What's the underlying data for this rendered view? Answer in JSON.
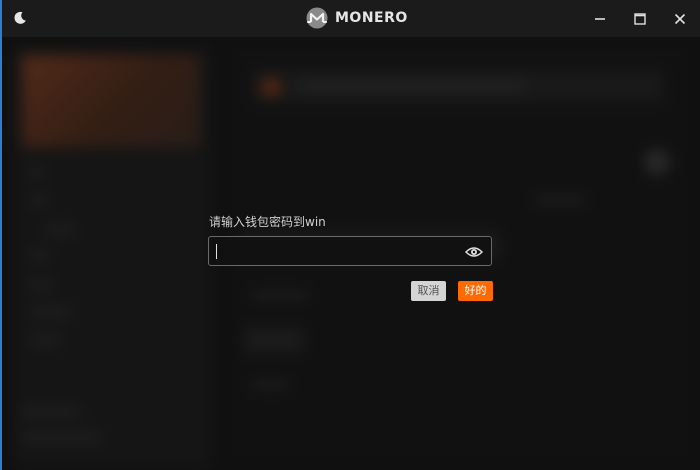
{
  "titlebar": {
    "app_name": "MONERO",
    "theme_toggle_icon": "moon-icon",
    "logo_icon": "monero-logo-icon",
    "controls": [
      "minimize-icon",
      "maximize-icon",
      "close-icon"
    ]
  },
  "dialog": {
    "prompt": "请输入钱包密码到win",
    "password_value": "",
    "reveal_icon": "eye-icon",
    "cancel_label": "取消",
    "ok_label": "好的"
  },
  "colors": {
    "accent": "#ff6a00",
    "titlebar_bg": "#1b1b1b",
    "window_bg": "#141414",
    "field_border": "#6a6a6a",
    "cancel_bg": "#d4d4d4"
  }
}
